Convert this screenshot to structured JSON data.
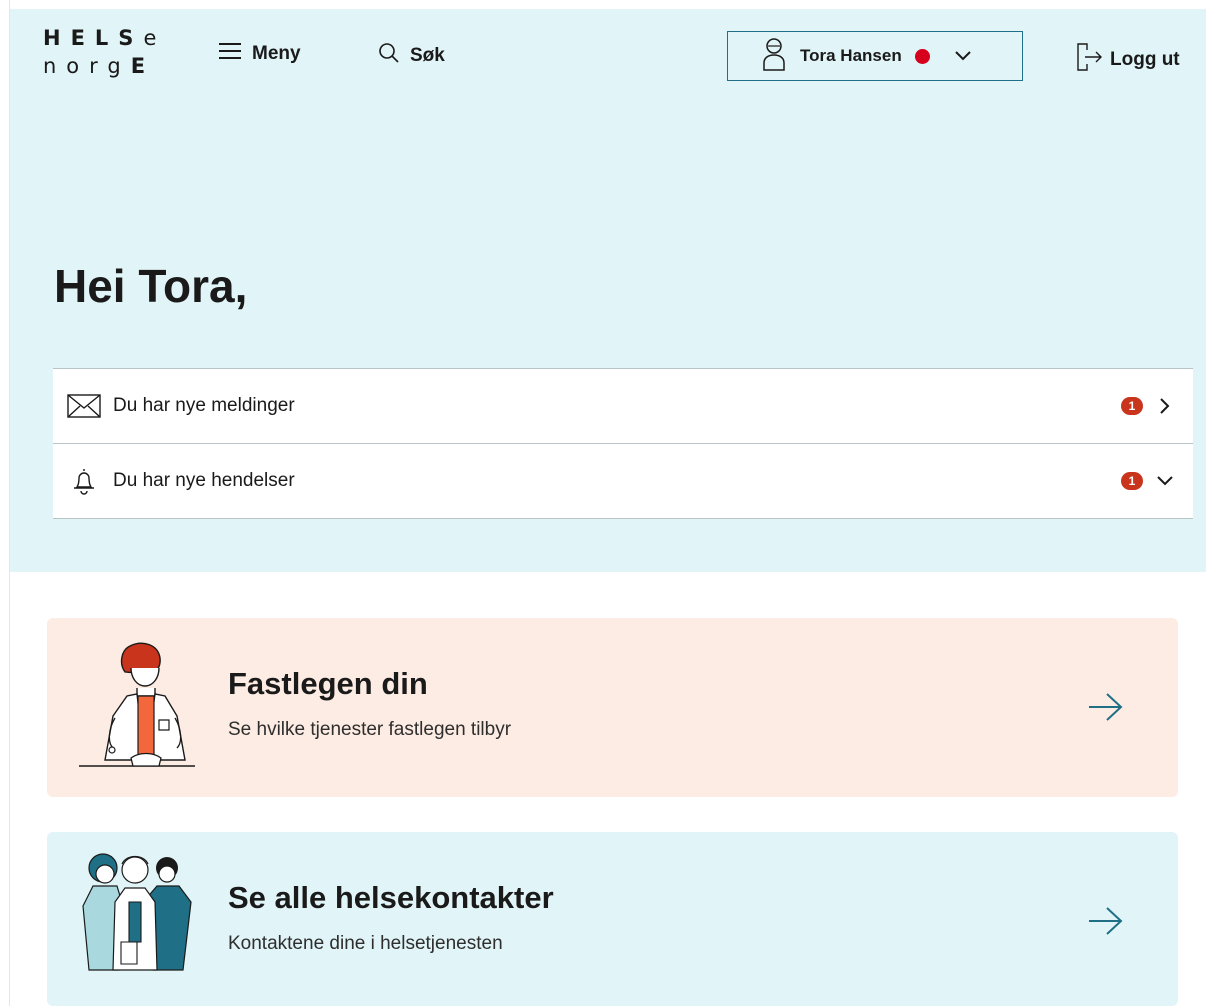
{
  "header": {
    "logo": {
      "line1_bold": "HELS",
      "line1_thin": "e",
      "line2_thin": "norg",
      "line2_bold": "E"
    },
    "menu_label": "Meny",
    "search_label": "Søk",
    "user_name": "Tora Hansen",
    "logout_label": "Logg ut"
  },
  "greeting": "Hei Tora,",
  "notifications": [
    {
      "label": "Du har nye meldinger",
      "count": "1",
      "icon": "envelope-icon",
      "chevron": "chevron-right-icon"
    },
    {
      "label": "Du har nye hendelser",
      "count": "1",
      "icon": "bell-icon",
      "chevron": "chevron-down-icon"
    }
  ],
  "cards": [
    {
      "title": "Fastlegen din",
      "subtitle": "Se hvilke tjenester fastlegen tilbyr",
      "illustration": "doctor-illustration"
    },
    {
      "title": "Se alle helsekontakter",
      "subtitle": "Kontaktene dine i helsetjenesten",
      "illustration": "health-contacts-illustration"
    }
  ],
  "colors": {
    "hero_bg": "#e1f4f7",
    "doctor_card_bg": "#fdece3",
    "accent": "#1f6f86",
    "badge": "#c8341c",
    "status_dot": "#d6001c"
  }
}
